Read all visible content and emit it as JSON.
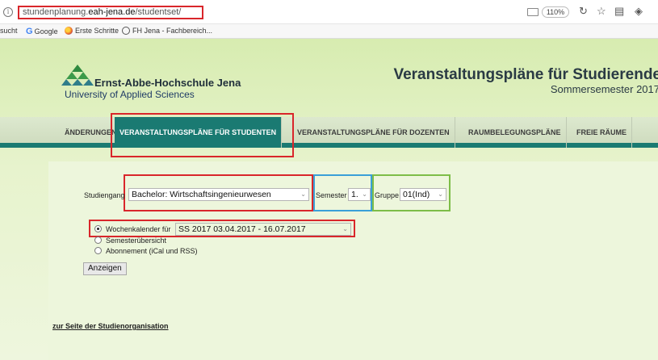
{
  "browser": {
    "url_prefix": "stundenplanung.",
    "url_domain": "eah-jena.de",
    "url_path": "/studentset/",
    "zoom": "110%",
    "bookmarks": [
      "sucht",
      "Google",
      "Erste Schritte",
      "FH Jena - Fachbereich..."
    ]
  },
  "header": {
    "university_name": "Ernst-Abbe-Hochschule Jena",
    "university_sub": "University of Applied Sciences",
    "title": "Veranstaltungspläne für Studierende",
    "subtitle": "Sommersemester 2017"
  },
  "nav": {
    "items": [
      "ÄNDERUNGEN",
      "VERANSTALTUNGSPLÄNE FÜR STUDENTEN",
      "VERANSTALTUNGSPLÄNE FÜR DOZENTEN",
      "RAUMBELEGUNGSPLÄNE",
      "FREIE RÄUME"
    ],
    "active_index": 1
  },
  "form": {
    "studiengang_label": "Studiengang",
    "studiengang_value": "Bachelor:  Wirtschaftsingenieurwesen",
    "semester_label": "Semester",
    "semester_value": "1.",
    "gruppe_label": "Gruppe",
    "gruppe_value": "01(Ind)",
    "options": {
      "wochenkalender": "Wochenkalender für",
      "semesteruebersicht": "Semesterübersicht",
      "abonnement": "Abonnement (iCal und RSS)"
    },
    "period_value": "SS 2017 03.04.2017 - 16.07.2017",
    "selected_option": "wochenkalender",
    "submit_label": "Anzeigen"
  },
  "footer_link": "zur Seite der Studienorganisation",
  "colors": {
    "highlight_red": "#d9262b",
    "highlight_blue": "#3aa0d8",
    "highlight_green": "#7dbd48",
    "nav_active": "#1a7a72",
    "page_green": "#d7ecb0"
  }
}
